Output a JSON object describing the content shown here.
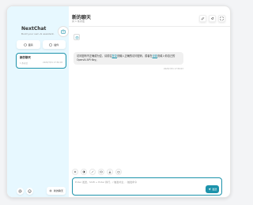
{
  "sidebar": {
    "brand_title": "NextChat",
    "brand_subtitle": "Build your own AI assistant.",
    "mask_button": "面具",
    "plugin_button": "插件",
    "chat_item": {
      "title": "新的聊天",
      "count": "1 条对话",
      "time": "2023/7/31 17:56:03"
    },
    "new_chat_button": "新的聊天"
  },
  "header": {
    "title": "新的聊天",
    "subtitle": "共 1 条对话"
  },
  "message": {
    "part1": "访问密码不正确或为空，请前往",
    "link1": "登录",
    "part2": "页输入正确的访问密码，或者在",
    "link2": "设置",
    "part3": "页填入你自己的 OpenAI API Key。",
    "date": "2023/7/31 17:56:03"
  },
  "input": {
    "placeholder": "Enter 发送，Shift + Enter 换行，/ 触发补全，: 触发命令"
  },
  "send_button": "发送",
  "colors": {
    "accent": "#1d93ab",
    "sidebar_bg": "#e7f8ff"
  },
  "icons": [
    "robot-icon",
    "mask-icon",
    "plugin-icon",
    "settings-icon",
    "github-icon",
    "add-icon",
    "edit-icon",
    "share-icon",
    "expand-icon",
    "send-icon"
  ]
}
